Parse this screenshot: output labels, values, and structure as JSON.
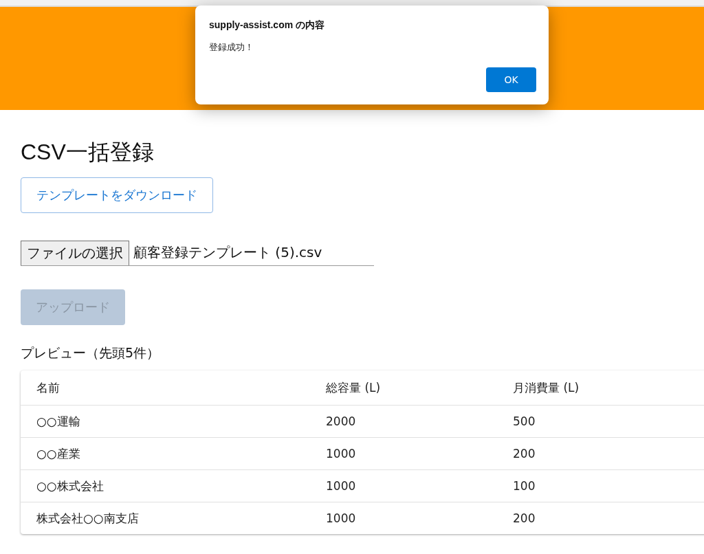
{
  "dialog": {
    "title": "supply-assist.com の内容",
    "message": "登録成功！",
    "ok_button": "OK"
  },
  "page": {
    "title": "CSV一括登録",
    "download_button": "テンプレートをダウンロード",
    "file_picker": {
      "button": "ファイルの選択",
      "value": "顧客登録テンプレート (5).csv"
    },
    "upload_button": {
      "label": "アップロード",
      "disabled": true
    },
    "preview_title": "プレビュー（先頭5件）"
  },
  "table": {
    "columns": [
      "名前",
      "総容量 (L)",
      "月消費量 (L)"
    ],
    "rows": [
      [
        "○○運輸",
        "2000",
        "500"
      ],
      [
        "○○産業",
        "1000",
        "200"
      ],
      [
        "○○株式会社",
        "1000",
        "100"
      ],
      [
        "株式会社○○南支店",
        "1000",
        "200"
      ]
    ]
  }
}
